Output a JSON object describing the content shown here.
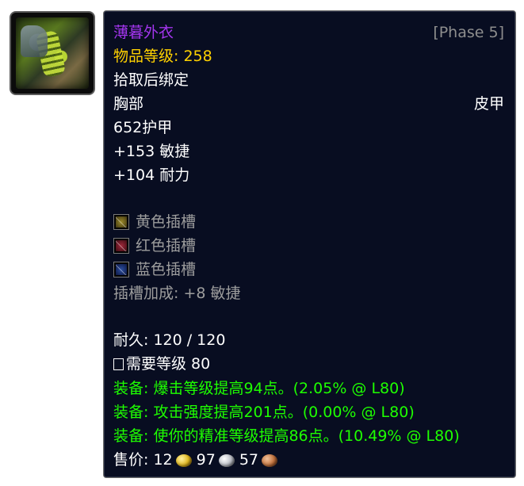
{
  "icon": {
    "name": "chest-armor-icon"
  },
  "item": {
    "name": "薄暮外衣",
    "phase": "[Phase 5]",
    "item_level": "物品等级: 258",
    "bind": "拾取后绑定",
    "slot": "胸部",
    "armor_type": "皮甲",
    "armor": "652护甲",
    "stats": [
      "+153 敏捷",
      "+104 耐力"
    ],
    "sockets": [
      {
        "color": "yellow",
        "label": "黄色插槽"
      },
      {
        "color": "red",
        "label": "红色插槽"
      },
      {
        "color": "blue",
        "label": "蓝色插槽"
      }
    ],
    "socket_bonus": "插槽加成: +8 敏捷",
    "durability": "耐久: 120 / 120",
    "required_level": "需要等级 80",
    "equip_effects": [
      "装备: 爆击等级提高94点。(2.05% @ L80)",
      "装备: 攻击强度提高201点。(0.00% @ L80)",
      "装备: 使你的精准等级提高86点。(10.49% @ L80)"
    ],
    "sell_price": {
      "label": "售价:",
      "gold": "12",
      "silver": "97",
      "copper": "57"
    }
  },
  "colors": {
    "epic": "#a335ee",
    "phase": "#8e8e8e",
    "item_level": "#ffd100",
    "socket_text": "#9d9d9d",
    "equip": "#1eff00",
    "background": "#080d21"
  }
}
